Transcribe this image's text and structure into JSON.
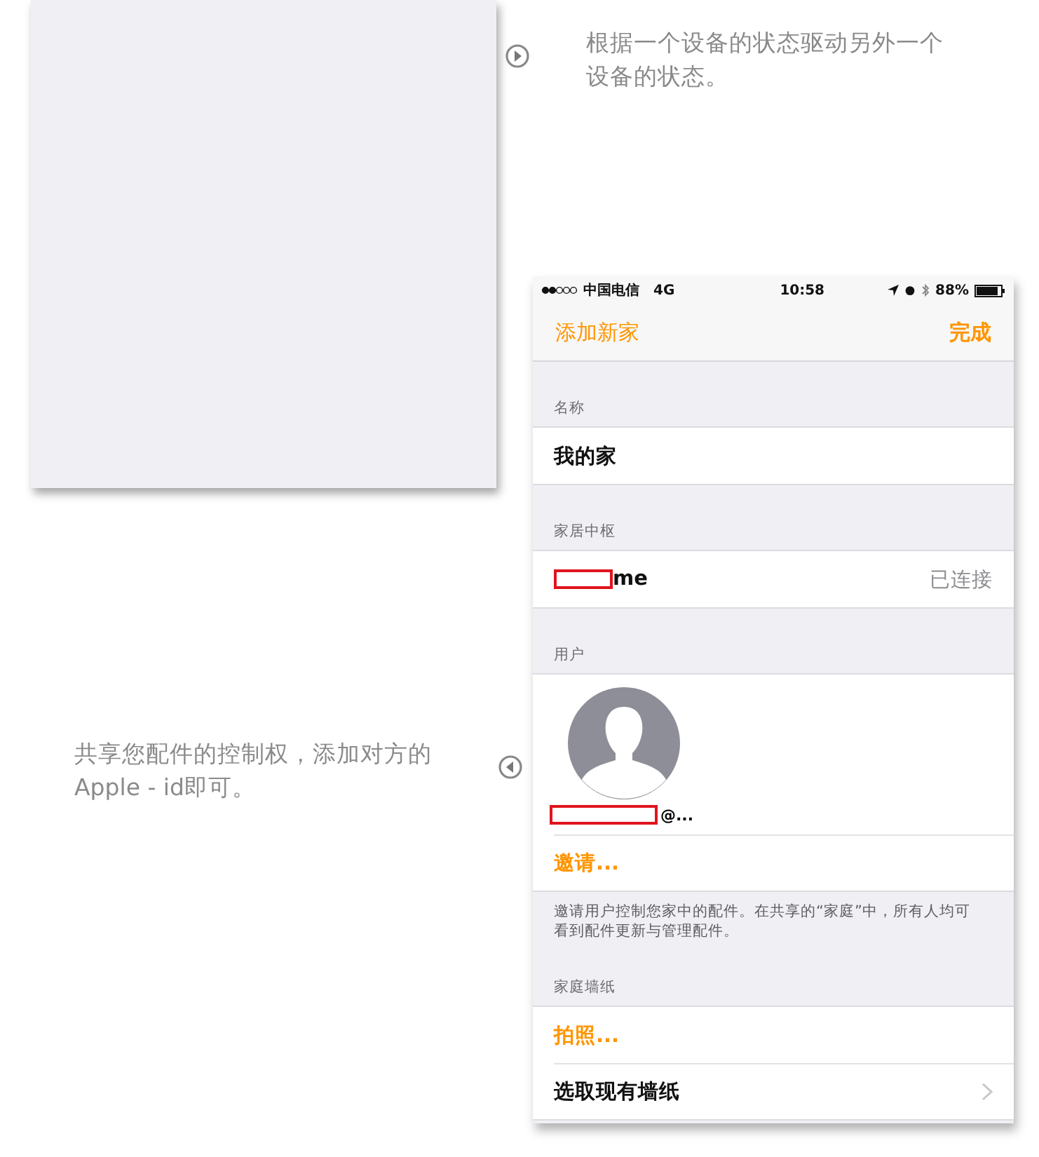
{
  "captions": [
    {
      "kind": "right",
      "text": "根据一个设备的状态驱动另外一个设备的状态。"
    },
    {
      "kind": "left",
      "text": "共享您配件的控制权，添加对方的Apple - id即可。"
    }
  ],
  "phone": {
    "status_bar": {
      "carrier": "中国电信",
      "network": "4G",
      "time": "10:58",
      "battery": "88%"
    },
    "nav": {
      "title": "添加新家",
      "action": "完成"
    },
    "sections": [
      {
        "header": "名称",
        "rows": [
          {
            "kind": "text",
            "label": "我的家"
          }
        ]
      },
      {
        "header": "家居中枢",
        "rows": [
          {
            "kind": "hub",
            "label": "me",
            "detail": "已连接",
            "redacted": true
          }
        ]
      },
      {
        "header": "用户",
        "rows": [
          {
            "kind": "user",
            "label": "@...",
            "redacted": true
          },
          {
            "kind": "action",
            "label": "邀请..."
          }
        ],
        "footer": "邀请用户控制您家中的配件。在共享的“家庭”中，所有人均可看到配件更新与管理配件。"
      },
      {
        "header": "家庭墙纸",
        "rows": [
          {
            "kind": "action",
            "label": "拍照..."
          },
          {
            "kind": "link",
            "label": "选取现有墙纸"
          }
        ]
      }
    ]
  }
}
